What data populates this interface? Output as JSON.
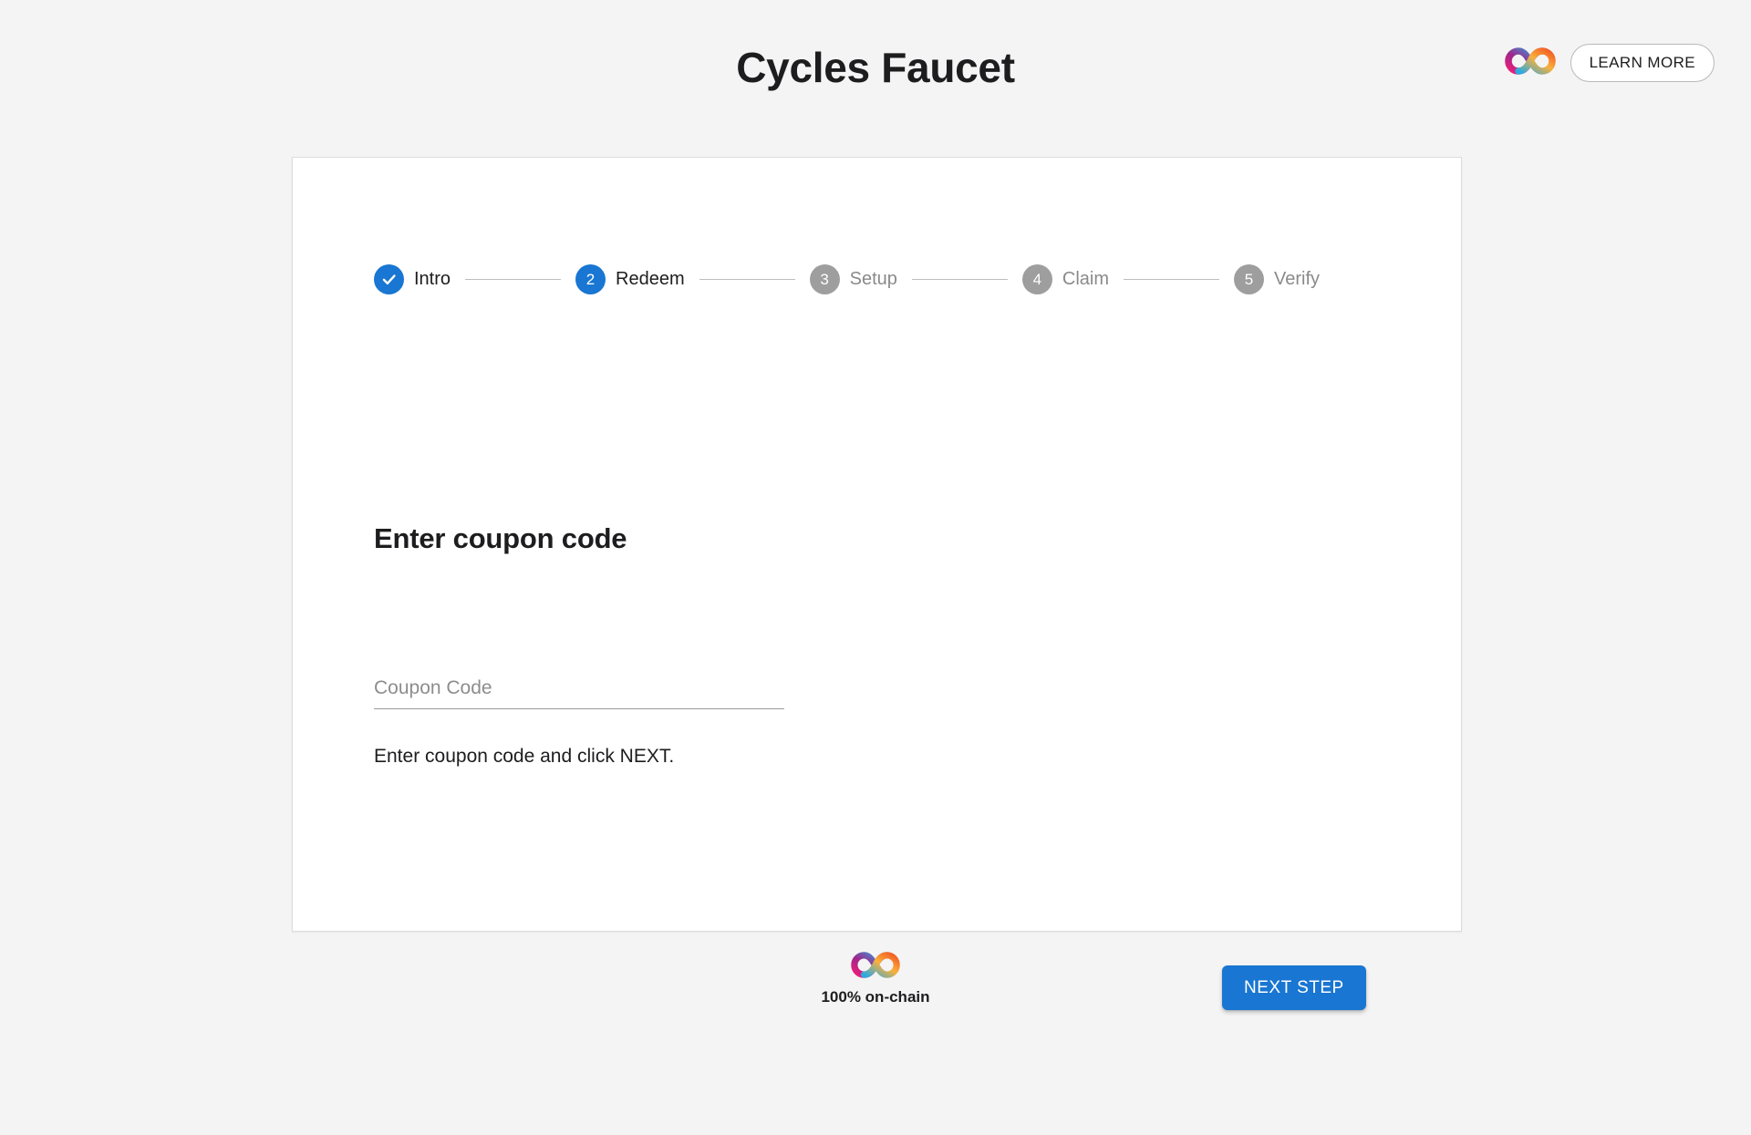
{
  "header": {
    "title": "Cycles Faucet",
    "logo_icon": "infinity-logo-icon",
    "learn_more_label": "LEARN MORE"
  },
  "stepper": {
    "steps": [
      {
        "number": "1",
        "badge": "check-icon",
        "label": "Intro",
        "state": "done"
      },
      {
        "number": "2",
        "badge": "2",
        "label": "Redeem",
        "state": "active"
      },
      {
        "number": "3",
        "badge": "3",
        "label": "Setup",
        "state": "pending"
      },
      {
        "number": "4",
        "badge": "4",
        "label": "Claim",
        "state": "pending"
      },
      {
        "number": "5",
        "badge": "5",
        "label": "Verify",
        "state": "pending"
      }
    ]
  },
  "main": {
    "heading": "Enter coupon code",
    "coupon_input": {
      "value": "",
      "placeholder": "Coupon Code"
    },
    "help_text": "Enter coupon code and click NEXT.",
    "next_step_label": "NEXT STEP"
  },
  "footer": {
    "logo_icon": "infinity-logo-icon",
    "caption": "100% on-chain"
  },
  "colors": {
    "page_background": "#f4f4f4",
    "card_background": "#ffffff",
    "accent_blue": "#1976d2",
    "pending_grey": "#9e9e9e",
    "text_primary": "#1d1d1f",
    "logo_purple": "#522785",
    "logo_magenta": "#ed1e79",
    "logo_orange": "#f15a24",
    "logo_cyan": "#29abe2"
  }
}
